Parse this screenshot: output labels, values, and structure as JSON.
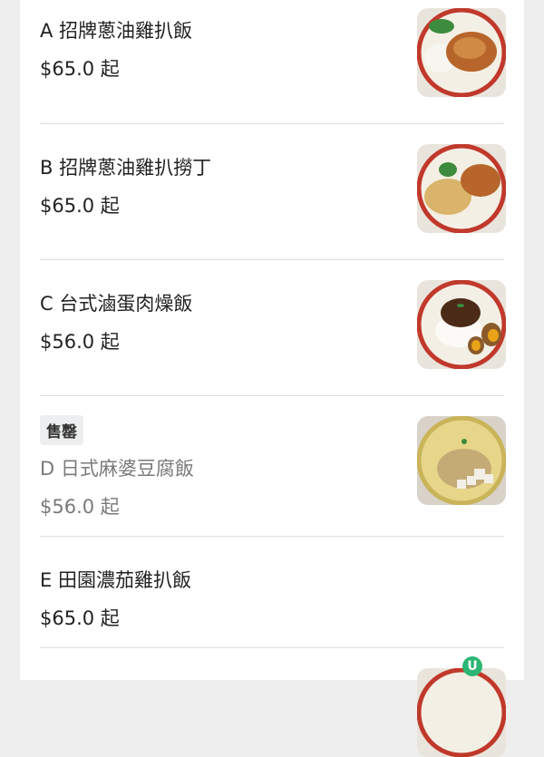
{
  "menu": {
    "items": [
      {
        "name": "A 招牌蔥油雞扒飯",
        "price": "$65.0 起",
        "image": "chicken-rice-photo"
      },
      {
        "name": "B 招牌蔥油雞扒撈丁",
        "price": "$65.0 起",
        "image": "chicken-noodles-photo"
      },
      {
        "name": "C 台式滷蛋肉燥飯",
        "price": "$56.0 起",
        "image": "braised-pork-rice-photo"
      },
      {
        "badge": "售罄",
        "name": "D 日式麻婆豆腐飯",
        "price": "$56.0 起",
        "image": "mapo-tofu-rice-photo"
      },
      {
        "name": "E 田園濃茄雞扒飯",
        "price": "$65.0 起"
      }
    ]
  },
  "colors": {
    "text": "#222222",
    "sold_out_text": "#7a7a7a",
    "badge_bg": "#eceeef",
    "divider": "#dedede",
    "logo_green": "#2bb673"
  },
  "watermark": {
    "logo": "U",
    "text": ""
  }
}
